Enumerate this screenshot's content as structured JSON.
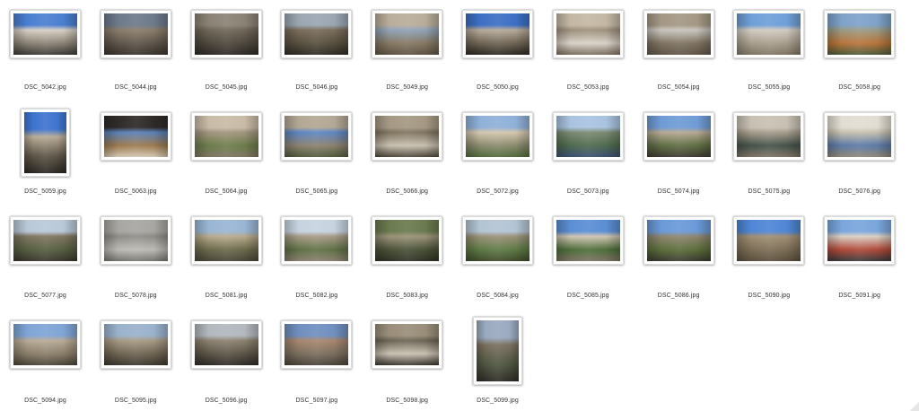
{
  "window": {
    "type": "finder-icon-view"
  },
  "files": [
    {
      "name": "DSC_5042.jpg",
      "orientation": "landscape",
      "colors": [
        "#4a7fd1",
        "#d8cfc4",
        "#8a8274",
        "#3b3a36"
      ]
    },
    {
      "name": "DSC_5044.jpg",
      "orientation": "landscape",
      "colors": [
        "#6d7a8a",
        "#8a7c6a",
        "#5e554a",
        "#3a342d"
      ]
    },
    {
      "name": "DSC_5045.jpg",
      "orientation": "landscape",
      "colors": [
        "#8b8275",
        "#6f6657",
        "#4e473d",
        "#2e2a25"
      ]
    },
    {
      "name": "DSC_5046.jpg",
      "orientation": "landscape",
      "colors": [
        "#9aa6b2",
        "#7a6b5a",
        "#58503f",
        "#2f2b25"
      ]
    },
    {
      "name": "DSC_5049.jpg",
      "orientation": "landscape",
      "colors": [
        "#b9ad9a",
        "#8fa2b8",
        "#857862",
        "#5c5243"
      ]
    },
    {
      "name": "DSC_5050.jpg",
      "orientation": "landscape",
      "colors": [
        "#3d6fc4",
        "#b7aa98",
        "#6e6454",
        "#2c2822"
      ]
    },
    {
      "name": "DSC_5053.jpg",
      "orientation": "landscape",
      "colors": [
        "#c4b8a4",
        "#9d8f7b",
        "#d8d2c8",
        "#7a6d5c"
      ]
    },
    {
      "name": "DSC_5054.jpg",
      "orientation": "landscape",
      "colors": [
        "#a49884",
        "#c9c5be",
        "#7f7361",
        "#5d5446"
      ]
    },
    {
      "name": "DSC_5055.jpg",
      "orientation": "landscape",
      "colors": [
        "#6f9fd8",
        "#d2cbc0",
        "#a79d8c",
        "#7e7462"
      ]
    },
    {
      "name": "DSC_5058.jpg",
      "orientation": "landscape",
      "colors": [
        "#7fa2c9",
        "#9a9a84",
        "#b8743a",
        "#4a5a3a"
      ]
    },
    {
      "name": "DSC_5059.jpg",
      "orientation": "portrait",
      "colors": [
        "#3f74cf",
        "#b8ab96",
        "#5c5446",
        "#2b2722"
      ]
    },
    {
      "name": "DSC_5063.jpg",
      "orientation": "landscape",
      "colors": [
        "#2f2b28",
        "#5a80b8",
        "#9c7a4e",
        "#d3c8b4"
      ]
    },
    {
      "name": "DSC_5064.jpg",
      "orientation": "landscape",
      "colors": [
        "#c9bba6",
        "#a2957f",
        "#6b7d4a",
        "#7e7462"
      ]
    },
    {
      "name": "DSC_5065.jpg",
      "orientation": "landscape",
      "colors": [
        "#b3a794",
        "#5c86c4",
        "#8c8170",
        "#4f5a3a"
      ]
    },
    {
      "name": "DSC_5066.jpg",
      "orientation": "landscape",
      "colors": [
        "#a59984",
        "#7e735f",
        "#c8c0b0",
        "#4e463a"
      ]
    },
    {
      "name": "DSC_5072.jpg",
      "orientation": "landscape",
      "colors": [
        "#8fb0d8",
        "#d4c6ae",
        "#8a8a6e",
        "#4f6a3a"
      ]
    },
    {
      "name": "DSC_5073.jpg",
      "orientation": "landscape",
      "colors": [
        "#a9c3e0",
        "#7b8a72",
        "#4f6a4e",
        "#3a5070"
      ]
    },
    {
      "name": "DSC_5074.jpg",
      "orientation": "landscape",
      "colors": [
        "#6f9cd6",
        "#b6a892",
        "#5f6e44",
        "#3f3a32"
      ]
    },
    {
      "name": "DSC_5075.jpg",
      "orientation": "landscape",
      "colors": [
        "#c8c0b2",
        "#a69c8c",
        "#44524a",
        "#7e7464"
      ]
    },
    {
      "name": "DSC_5076.jpg",
      "orientation": "landscape",
      "colors": [
        "#e2ddd2",
        "#c6bfae",
        "#5b79a6",
        "#8f8876"
      ]
    },
    {
      "name": "DSC_5077.jpg",
      "orientation": "landscape",
      "colors": [
        "#b9c9d8",
        "#7f7560",
        "#555f40",
        "#3a3630"
      ]
    },
    {
      "name": "DSC_5078.jpg",
      "orientation": "landscape",
      "colors": [
        "#a7a6a2",
        "#8e8c86",
        "#bcbbb6",
        "#76746e"
      ]
    },
    {
      "name": "DSC_5081.jpg",
      "orientation": "landscape",
      "colors": [
        "#9ab6d4",
        "#b8a98c",
        "#6b6a4c",
        "#4a4538"
      ]
    },
    {
      "name": "DSC_5082.jpg",
      "orientation": "landscape",
      "colors": [
        "#c6d3e0",
        "#a69a86",
        "#5f7045",
        "#8a8070"
      ]
    },
    {
      "name": "DSC_5083.jpg",
      "orientation": "landscape",
      "colors": [
        "#6b7a4f",
        "#9a9278",
        "#4a5238",
        "#2f3326"
      ]
    },
    {
      "name": "DSC_5084.jpg",
      "orientation": "landscape",
      "colors": [
        "#b3c4d4",
        "#9a9078",
        "#5d7a44",
        "#3f4a2c"
      ]
    },
    {
      "name": "DSC_5085.jpg",
      "orientation": "landscape",
      "colors": [
        "#5b8ed4",
        "#d0c4b2",
        "#4e6e3a",
        "#7b7262"
      ]
    },
    {
      "name": "DSC_5086.jpg",
      "orientation": "landscape",
      "colors": [
        "#6a9ad8",
        "#8e8470",
        "#5b6e3a",
        "#3b3a30"
      ]
    },
    {
      "name": "DSC_5090.jpg",
      "orientation": "landscape",
      "colors": [
        "#4f86d6",
        "#9f8e74",
        "#7c6d55",
        "#5a4e3c"
      ]
    },
    {
      "name": "DSC_5091.jpg",
      "orientation": "landscape",
      "colors": [
        "#7aa6dc",
        "#d9cfc4",
        "#b04a3a",
        "#3a3a3a"
      ]
    },
    {
      "name": "DSC_5094.jpg",
      "orientation": "landscape",
      "colors": [
        "#7fa5d6",
        "#b7aa96",
        "#8a7e6a",
        "#4a4438"
      ]
    },
    {
      "name": "DSC_5095.jpg",
      "orientation": "landscape",
      "colors": [
        "#9ab2cc",
        "#a89a84",
        "#6e6452",
        "#3c372f"
      ]
    },
    {
      "name": "DSC_5096.jpg",
      "orientation": "landscape",
      "colors": [
        "#b2b8be",
        "#8c8270",
        "#5c5447",
        "#2f2b27"
      ]
    },
    {
      "name": "DSC_5097.jpg",
      "orientation": "landscape",
      "colors": [
        "#6f8fbf",
        "#a8866e",
        "#7a6e5e",
        "#4a4238"
      ]
    },
    {
      "name": "DSC_5098.jpg",
      "orientation": "landscape",
      "colors": [
        "#9a8e7a",
        "#6b6354",
        "#c9c1b1",
        "#3a352e"
      ]
    },
    {
      "name": "DSC_5099.jpg",
      "orientation": "portrait",
      "colors": [
        "#9aaac0",
        "#7b7060",
        "#4f5640",
        "#2f2c27"
      ]
    }
  ]
}
